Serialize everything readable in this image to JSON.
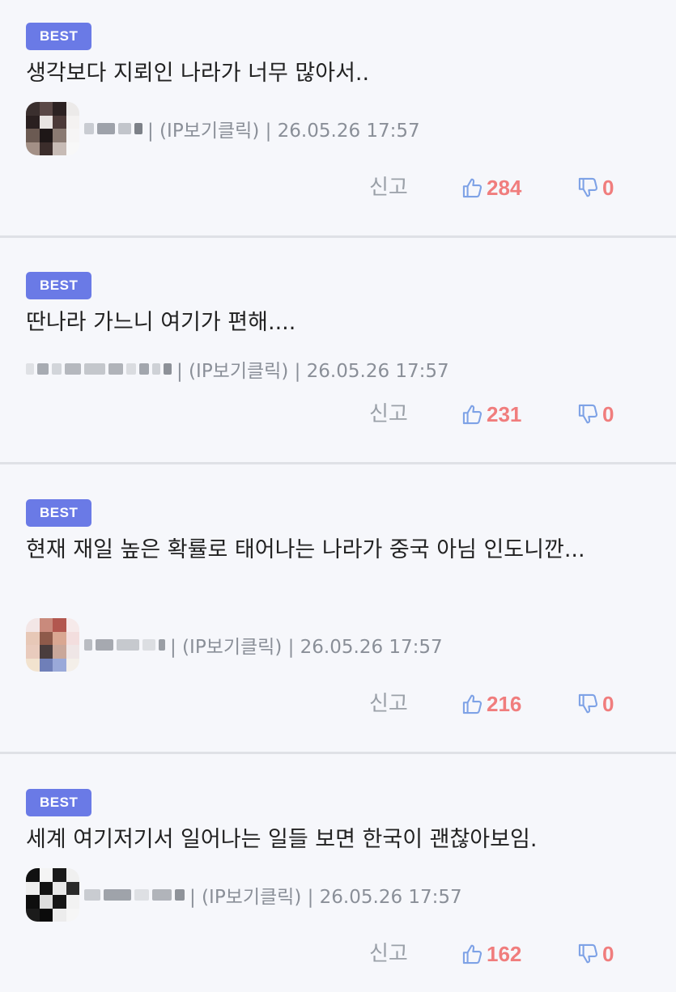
{
  "comments": [
    {
      "badge": "BEST",
      "text": "생각보다 지뢰인 나라가 너무 많아서..",
      "meta": "| (IP보기클릭) | 26.05.26 17:57",
      "report": "신고",
      "likes": "284",
      "dislikes": "0"
    },
    {
      "badge": "BEST",
      "text": "딴나라 가느니 여기가 편해....",
      "meta": "| (IP보기클릭) | 26.05.26 17:57",
      "report": "신고",
      "likes": "231",
      "dislikes": "0"
    },
    {
      "badge": "BEST",
      "text": "현재 재일 높은 확률로 태어나는 나라가 중국 아님 인도니깐...",
      "meta": "| (IP보기클릭) | 26.05.26 17:57",
      "report": "신고",
      "likes": "216",
      "dislikes": "0"
    },
    {
      "badge": "BEST",
      "text": "세계 여기저기서 일어나는 일들 보면 한국이 괜찮아보임.",
      "meta": "| (IP보기클릭) | 26.05.26 17:57",
      "report": "신고",
      "likes": "162",
      "dislikes": "0"
    }
  ],
  "icons": {
    "like": "thumbs-up-icon",
    "dislike": "thumbs-down-icon"
  },
  "colors": {
    "badge": "#6a7ae6",
    "count": "#f07d7d",
    "thumb": "#7ea2e6"
  }
}
